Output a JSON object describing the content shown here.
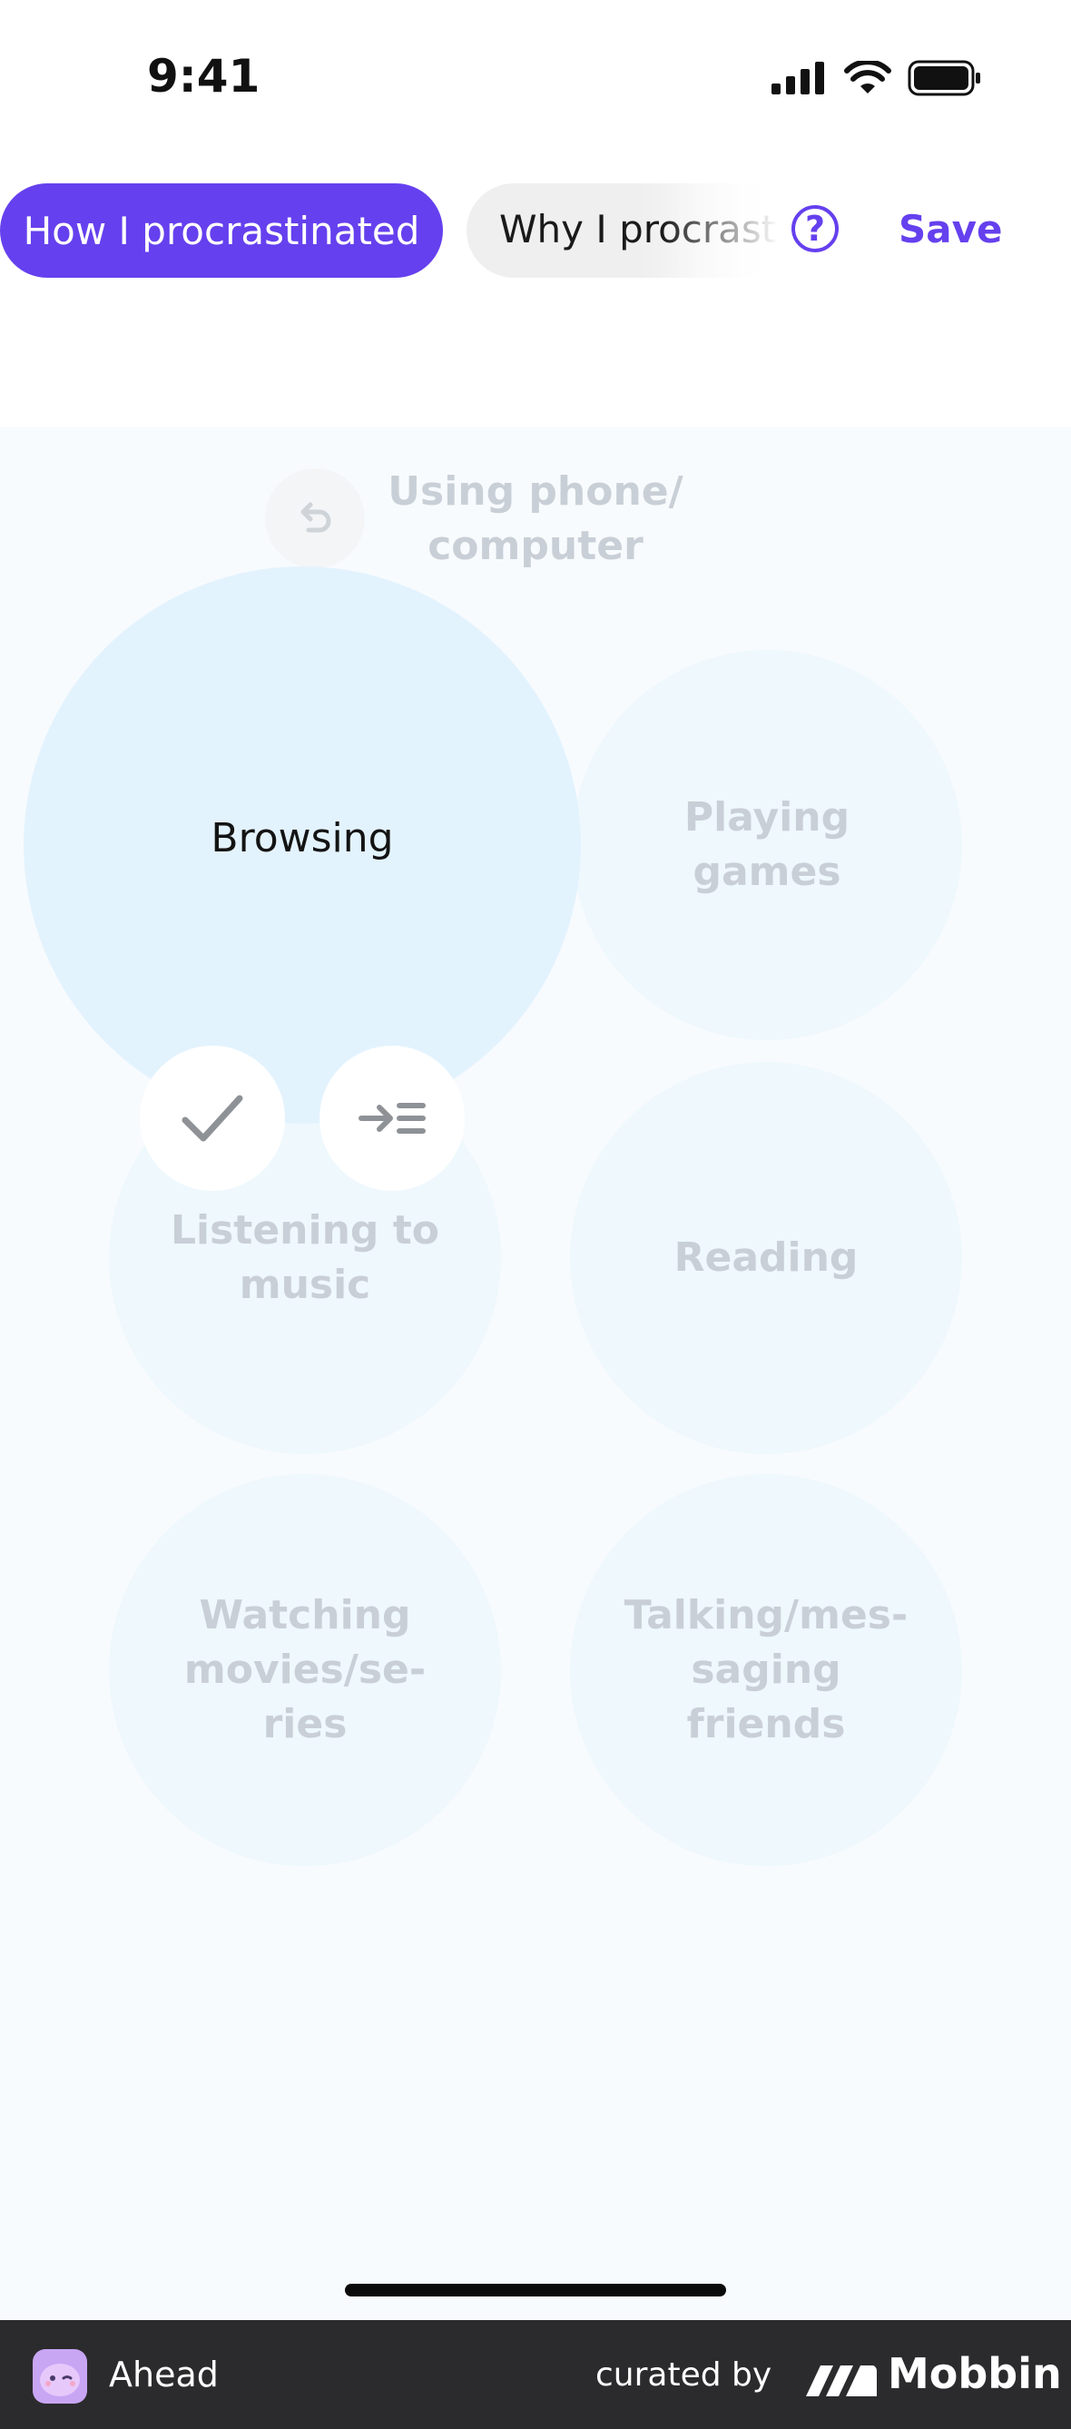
{
  "status_bar": {
    "time": "9:41"
  },
  "header": {
    "tabs": [
      {
        "label": "How I procrastinated",
        "active": true
      },
      {
        "label": "Why I procrastinated",
        "active": false
      }
    ],
    "help_label": "?",
    "save_label": "Save"
  },
  "canvas": {
    "parent_label": "Using phone/\ncomputer",
    "bubbles": [
      {
        "label": "Browsing",
        "selected": true
      },
      {
        "label": "Playing\ngames"
      },
      {
        "label": "Listening to\nmusic"
      },
      {
        "label": "Reading"
      },
      {
        "label": "Watching\nmovies/se-\nries"
      },
      {
        "label": "Talking/mes-\nsaging\nfriends"
      }
    ]
  },
  "footer": {
    "app_name": "Ahead",
    "curated_by": "curated by",
    "brand": "Mobbin"
  },
  "colors": {
    "accent": "#6540ee",
    "bubble": "#eef8fd",
    "bubble_selected": "#e3f3fe",
    "footer_bg": "#2b2b2d"
  },
  "icons": {
    "undo": "undo-icon",
    "check": "check-icon",
    "expand": "expand-icon"
  }
}
